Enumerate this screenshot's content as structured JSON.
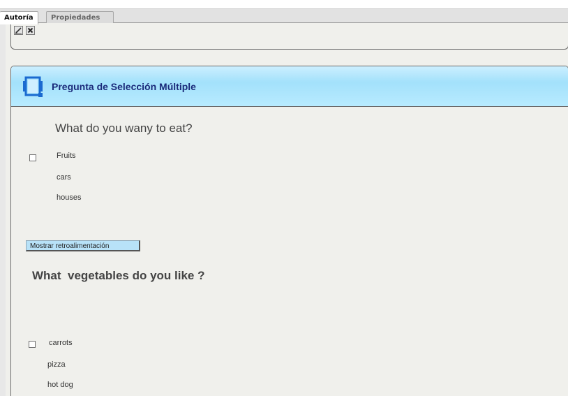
{
  "tabs": [
    {
      "label": "Autoría",
      "active": true
    },
    {
      "label": "Propiedades",
      "active": false
    }
  ],
  "toolbar": {
    "buttons": [
      {
        "name": "edit",
        "icon": "pencil-icon"
      },
      {
        "name": "delete",
        "icon": "close-icon"
      }
    ]
  },
  "idevice": {
    "title": "Pregunta de Selección Múltiple",
    "icon": "multi-choice-icon",
    "header_color": "#a9e3fb"
  },
  "question1": {
    "text": "What do you wany to eat?",
    "options": [
      "Fruits",
      "cars",
      "houses"
    ]
  },
  "feedback_button": {
    "label": "Mostrar retroalimentación"
  },
  "question2": {
    "text": "What  vegetables do you like ?",
    "options": [
      "carrots",
      "pizza",
      "hot dog"
    ]
  }
}
